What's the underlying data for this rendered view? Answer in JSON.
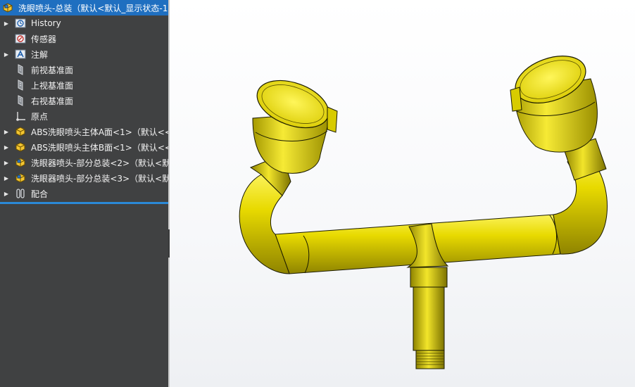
{
  "feature_tree": {
    "root": {
      "label": "洗眼喷头-总装（默认<默认_显示状态-1",
      "icon": "assembly-icon"
    },
    "items": [
      {
        "label": "History",
        "icon": "history-icon",
        "expandable": true
      },
      {
        "label": "传感器",
        "icon": "sensor-icon",
        "expandable": false
      },
      {
        "label": "注解",
        "icon": "annotation-icon",
        "expandable": true
      },
      {
        "label": "前视基准面",
        "icon": "plane-icon",
        "expandable": false
      },
      {
        "label": "上视基准面",
        "icon": "plane-icon",
        "expandable": false
      },
      {
        "label": "右视基准面",
        "icon": "plane-icon",
        "expandable": false
      },
      {
        "label": "原点",
        "icon": "origin-icon",
        "expandable": false
      },
      {
        "label": "ABS洗眼喷头主体A面<1>（默认<<",
        "icon": "part-icon",
        "expandable": true
      },
      {
        "label": "ABS洗眼喷头主体B面<1>（默认<<",
        "icon": "part-icon",
        "expandable": true
      },
      {
        "label": "洗眼器喷头-部分总装<2>（默认<默",
        "icon": "subassembly-icon",
        "expandable": true
      },
      {
        "label": "洗眼器喷头-部分总装<3>（默认<默",
        "icon": "subassembly-icon",
        "expandable": true
      },
      {
        "label": "配合",
        "icon": "mates-icon",
        "expandable": true
      }
    ]
  },
  "colors": {
    "panel_bg": "#404142",
    "root_highlight": "#1f6fc0",
    "model_yellow": "#e6d800",
    "model_edge": "#1a1a00"
  }
}
